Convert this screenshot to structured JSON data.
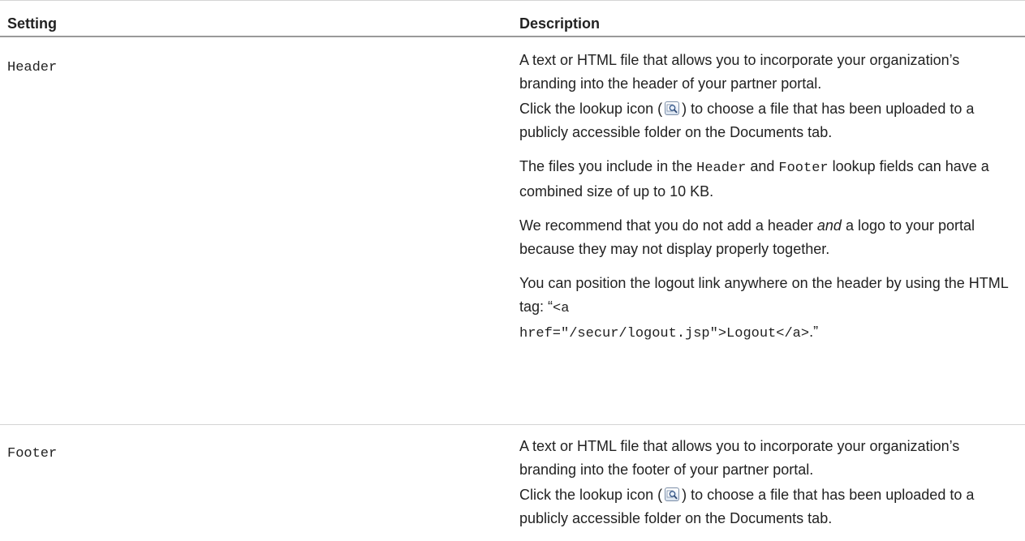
{
  "table": {
    "headers": {
      "setting": "Setting",
      "description": "Description"
    },
    "rows": [
      {
        "setting": "Header",
        "description": {
          "p1": "A text or HTML file that allows you to incorporate your organization’s branding into the header of your partner portal.",
          "p2_before": "Click the lookup icon (",
          "p2_after": ") to choose a file that has been uploaded to a publicly accessible folder on the Documents tab.",
          "p3_before": "The files you include in the ",
          "p3_code1": "Header",
          "p3_mid": " and ",
          "p3_code2": "Footer",
          "p3_after": " lookup fields can have a combined size of up to 10 KB.",
          "p4_before": "We recommend that you do not add a header ",
          "p4_em": "and",
          "p4_after": " a logo to your portal because they may not display properly together.",
          "p5_before": "You can position the logout link anywhere on the header by using the HTML tag: “",
          "p5_code_a": "<a",
          "p5_code_b": "href=\"/secur/logout.jsp\">Logout</a>",
          "p5_after": ".”"
        }
      },
      {
        "setting": "Footer",
        "description": {
          "p1": "A text or HTML file that allows you to incorporate your organization’s branding into the footer of your partner portal.",
          "p2_before": "Click the lookup icon (",
          "p2_after": ") to choose a file that has been uploaded to a publicly accessible folder on the Documents tab."
        }
      }
    ]
  },
  "icons": {
    "lookup": "lookup-magnifier-icon"
  }
}
